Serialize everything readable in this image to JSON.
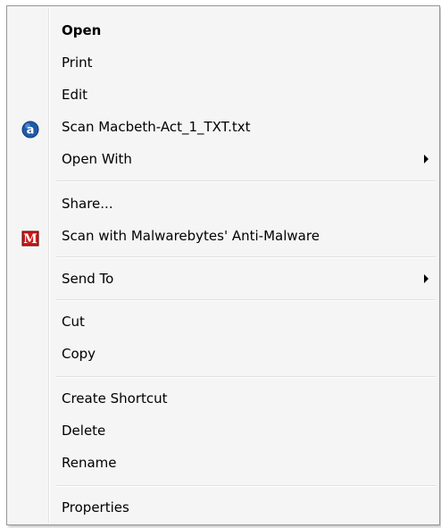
{
  "context_menu": {
    "items": [
      {
        "label": "Open"
      },
      {
        "label": "Print"
      },
      {
        "label": "Edit"
      },
      {
        "label": "Scan Macbeth-Act_1_TXT.txt",
        "icon": "avast-antivirus-icon"
      },
      {
        "label": "Open With"
      },
      {
        "label": "Share..."
      },
      {
        "label": "Scan with Malwarebytes' Anti-Malware",
        "icon": "malwarebytes-icon"
      },
      {
        "label": "Send To"
      },
      {
        "label": "Cut"
      },
      {
        "label": "Copy"
      },
      {
        "label": "Create Shortcut"
      },
      {
        "label": "Delete"
      },
      {
        "label": "Rename"
      },
      {
        "label": "Properties"
      }
    ],
    "icon_letters": {
      "avast": "a",
      "malwarebytes": "M"
    }
  },
  "colors": {
    "menu_background": "#f5f5f5",
    "menu_border": "#979797",
    "avast_blue": "#1e5aa8",
    "malwarebytes_red": "#cc1a1a"
  }
}
